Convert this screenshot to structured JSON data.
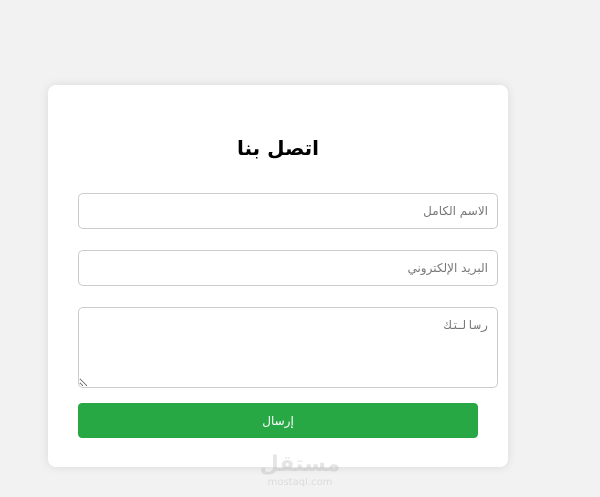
{
  "form": {
    "title": "اتصل بنا",
    "name_placeholder": "الاسم الكامل",
    "email_placeholder": "البريد الإلكتروني",
    "message_placeholder": "رسالتك",
    "submit_label": "إرسال"
  },
  "watermark": {
    "logo": "مستقل",
    "domain": "mostaql.com"
  },
  "colors": {
    "page_background": "#f2f2f2",
    "card_background": "#ffffff",
    "field_border": "#cccccc",
    "submit_button": "#28a745",
    "submit_text": "#ffffff"
  }
}
